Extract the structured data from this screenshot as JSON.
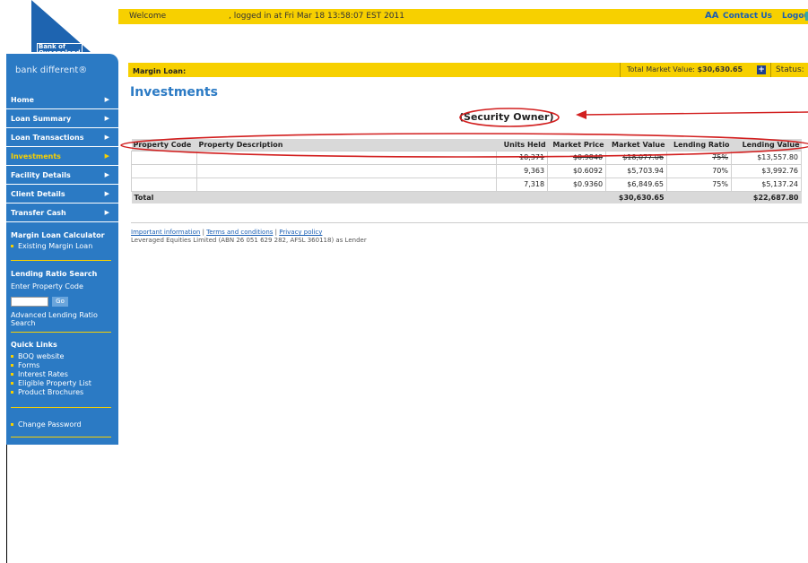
{
  "header": {
    "welcome": "Welcome",
    "logged_in": ", logged in at Fri Mar 18 13:58:07 EST 2011",
    "font_size_toggle": "AA",
    "contact_us": "Contact Us",
    "logout": "Logout"
  },
  "brand": {
    "logo_text": "Bank of Queensland",
    "tagline": "bank different®",
    "primary_color": "#2b7ac4",
    "accent_color": "#f7d000"
  },
  "sidebar": {
    "nav": [
      {
        "label": "Home"
      },
      {
        "label": "Loan Summary"
      },
      {
        "label": "Loan Transactions"
      },
      {
        "label": "Investments"
      },
      {
        "label": "Facility Details"
      },
      {
        "label": "Client Details"
      },
      {
        "label": "Transfer Cash"
      }
    ],
    "calculator_header": "Margin Loan Calculator",
    "calculator_link": "Existing Margin Loan",
    "lending_header": "Lending Ratio Search",
    "enter_code": "Enter Property Code",
    "go": "Go",
    "advanced": "Advanced Lending Ratio Search",
    "quick_links_header": "Quick Links",
    "quick_links": [
      "BOQ website",
      "Forms",
      "Interest Rates",
      "Eligible Property List",
      "Product Brochures"
    ],
    "change_password": "Change Password"
  },
  "loanbar": {
    "label": "Margin Loan:",
    "total_market_value_label": "Total Market Value:",
    "total_market_value": "$30,630.65",
    "plus": "+",
    "status_label": "Status:"
  },
  "page": {
    "title": "Investments",
    "security_owner": "(Security Owner)"
  },
  "table": {
    "headers": [
      "Property Code",
      "Property Description",
      "Units Held",
      "Market Price",
      "Market Value",
      "Lending Ratio",
      "Lending Value"
    ],
    "rows": [
      {
        "code": "",
        "desc": "",
        "units": "18,371",
        "price": "$0.9840",
        "value": "$18,077.06",
        "ratio": "75%",
        "lvalue": "$13,557.80"
      },
      {
        "code": "",
        "desc": "",
        "units": "9,363",
        "price": "$0.6092",
        "value": "$5,703.94",
        "ratio": "70%",
        "lvalue": "$3,992.76"
      },
      {
        "code": "",
        "desc": "",
        "units": "7,318",
        "price": "$0.9360",
        "value": "$6,849.65",
        "ratio": "75%",
        "lvalue": "$5,137.24"
      }
    ],
    "total_label": "Total",
    "total_value": "$30,630.65",
    "total_lending": "$22,687.80"
  },
  "footer": {
    "important": "Important information",
    "terms": "Terms and conditions",
    "privacy": "Privacy policy",
    "separator": "|",
    "lender": "Leveraged Equities Limited (ABN 26 051 629 282, AFSL 360118) as Lender"
  }
}
